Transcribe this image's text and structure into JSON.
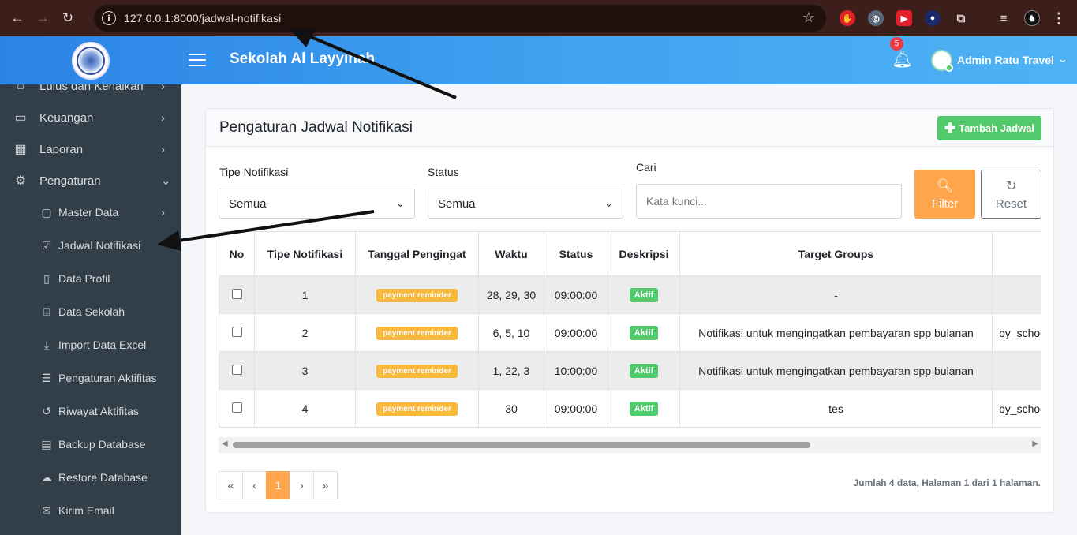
{
  "browser": {
    "url": "127.0.0.1:8000/jadwal-notifikasi",
    "back_icon": "←",
    "forward_icon": "→",
    "reload_icon": "↻",
    "star_icon": "☆",
    "menu_icon": "⋮"
  },
  "header": {
    "school_name": "Sekolah Al Layyinah",
    "notification_count": "5",
    "admin_name": "Admin Ratu Travel",
    "caret": "⌄"
  },
  "sidebar": {
    "items": [
      {
        "label": "Lulus dan Kenaikan",
        "icon": "graduation-icon"
      },
      {
        "label": "Keuangan",
        "icon": "wallet-icon"
      },
      {
        "label": "Laporan",
        "icon": "report-icon"
      },
      {
        "label": "Pengaturan",
        "icon": "gear-icon"
      }
    ],
    "subitems": [
      {
        "label": "Master Data",
        "icon": "file-icon"
      },
      {
        "label": "Jadwal Notifikasi",
        "icon": "calendar-check-icon"
      },
      {
        "label": "Data Profil",
        "icon": "id-badge-icon"
      },
      {
        "label": "Data Sekolah",
        "icon": "school-icon"
      },
      {
        "label": "Import Data Excel",
        "icon": "download-icon"
      },
      {
        "label": "Pengaturan Aktifitas",
        "icon": "list-icon"
      },
      {
        "label": "Riwayat Aktifitas",
        "icon": "history-icon"
      },
      {
        "label": "Backup Database",
        "icon": "database-icon"
      },
      {
        "label": "Restore Database",
        "icon": "cloud-upload-icon"
      },
      {
        "label": "Kirim Email",
        "icon": "mail-icon"
      }
    ]
  },
  "page": {
    "title": "Pengaturan Jadwal Notifikasi",
    "add_button": "Tambah Jadwal"
  },
  "filters": {
    "type_label": "Tipe Notifikasi",
    "type_value": "Semua",
    "status_label": "Status",
    "status_value": "Semua",
    "search_label": "Cari",
    "search_placeholder": "Kata kunci...",
    "filter_button": "Filter",
    "reset_button": "Reset"
  },
  "table": {
    "headers": [
      "No",
      "Tipe Notifikasi",
      "Tanggal Pengingat",
      "Waktu",
      "Status",
      "Deskripsi",
      "Target Groups",
      ""
    ],
    "rows": [
      {
        "checkbox": "",
        "no": "1",
        "tipe": "payment reminder",
        "tanggal": "28, 29, 30",
        "waktu": "09:00:00",
        "status": "Aktif",
        "deskripsi": "-",
        "target": ""
      },
      {
        "checkbox": "",
        "no": "2",
        "tipe": "payment reminder",
        "tanggal": "6, 5, 10",
        "waktu": "09:00:00",
        "status": "Aktif",
        "deskripsi": "Notifikasi untuk mengingatkan pembayaran spp bulanan",
        "target": "by_school"
      },
      {
        "checkbox": "",
        "no": "3",
        "tipe": "payment reminder",
        "tanggal": "1, 22, 3",
        "waktu": "10:00:00",
        "status": "Aktif",
        "deskripsi": "Notifikasi untuk mengingatkan pembayaran spp bulanan",
        "target": ""
      },
      {
        "checkbox": "",
        "no": "4",
        "tipe": "payment reminder",
        "tanggal": "30",
        "waktu": "09:00:00",
        "status": "Aktif",
        "deskripsi": "tes",
        "target": "by_school"
      }
    ]
  },
  "pagination": {
    "first": "«",
    "prev": "‹",
    "current": "1",
    "next": "›",
    "last": "»",
    "info": "Jumlah 4 data, Halaman 1 dari 1 halaman."
  },
  "colors": {
    "header_start": "#2b83e6",
    "header_end": "#4fb2f4",
    "sidebar_bg": "#323e48",
    "accent_orange": "#ffa64d",
    "success_green": "#52c96b",
    "warning_yellow": "#f9b93c",
    "annotation_arrow": "#111111"
  }
}
